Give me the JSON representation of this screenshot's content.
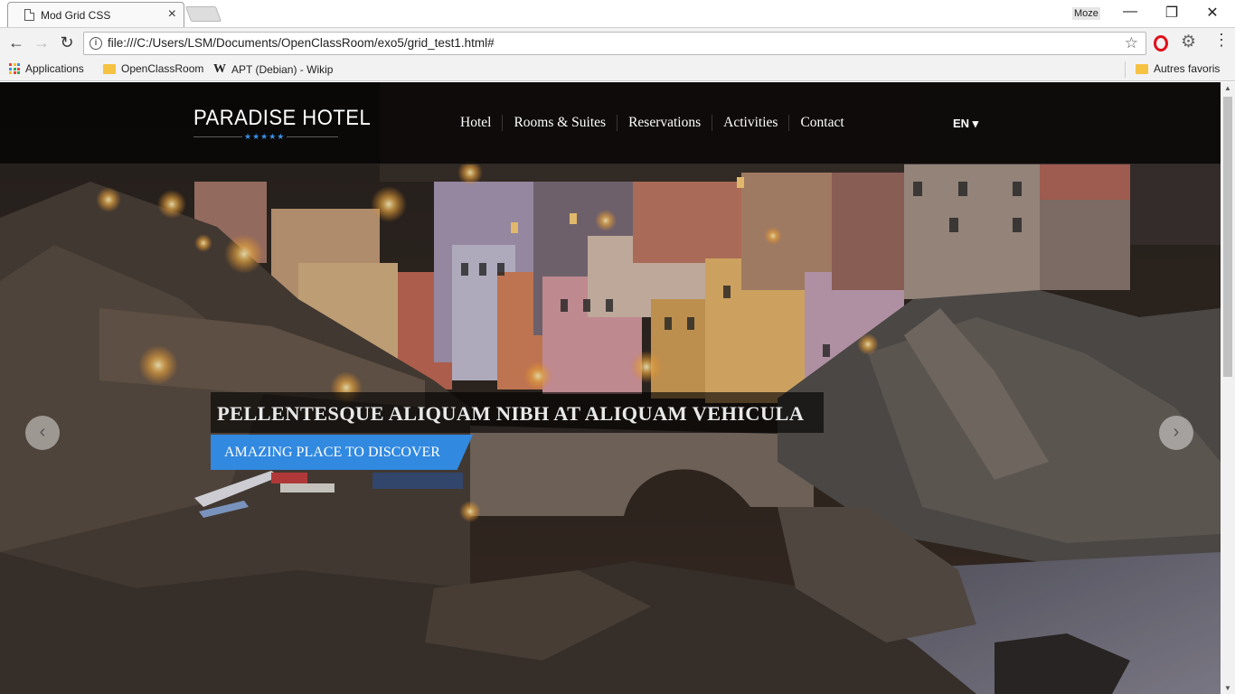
{
  "browser": {
    "tab_title": "Mod Grid CSS",
    "tab_close": "×",
    "profile_name": "Moze",
    "url": "file:///C:/Users/LSM/Documents/OpenClassRoom/exo5/grid_test1.html#",
    "window_controls": {
      "minimize": "—",
      "restore": "❐",
      "close": "✕"
    },
    "nav_icons": {
      "back": "←",
      "forward": "→",
      "reload": "↻",
      "star": "☆",
      "gear": "⚙",
      "menu": "⋮"
    },
    "bookmarks": [
      {
        "label": "Applications",
        "icon": "apps-grid-icon"
      },
      {
        "label": "OpenClassRoom",
        "icon": "folder-icon"
      },
      {
        "label": "APT (Debian) - Wikip",
        "icon": "wikipedia-icon"
      }
    ],
    "bookmarks_other": "Autres favoris"
  },
  "page": {
    "logo": "PARADISE HOTEL",
    "logo_stars": "★★★★★",
    "nav": [
      "Hotel",
      "Rooms & Suites",
      "Reservations",
      "Activities",
      "Contact"
    ],
    "language": "EN ▾",
    "slider": {
      "headline": "PELLENTESQUE ALIQUAM NIBH AT ALIQUAM VEHICULA",
      "subline": "AMAZING PLACE TO DISCOVER",
      "prev": "‹",
      "next": "›"
    }
  },
  "colors": {
    "accent": "#3189e0",
    "header_bg": "#000000",
    "star_blue": "#3b8fe6"
  }
}
